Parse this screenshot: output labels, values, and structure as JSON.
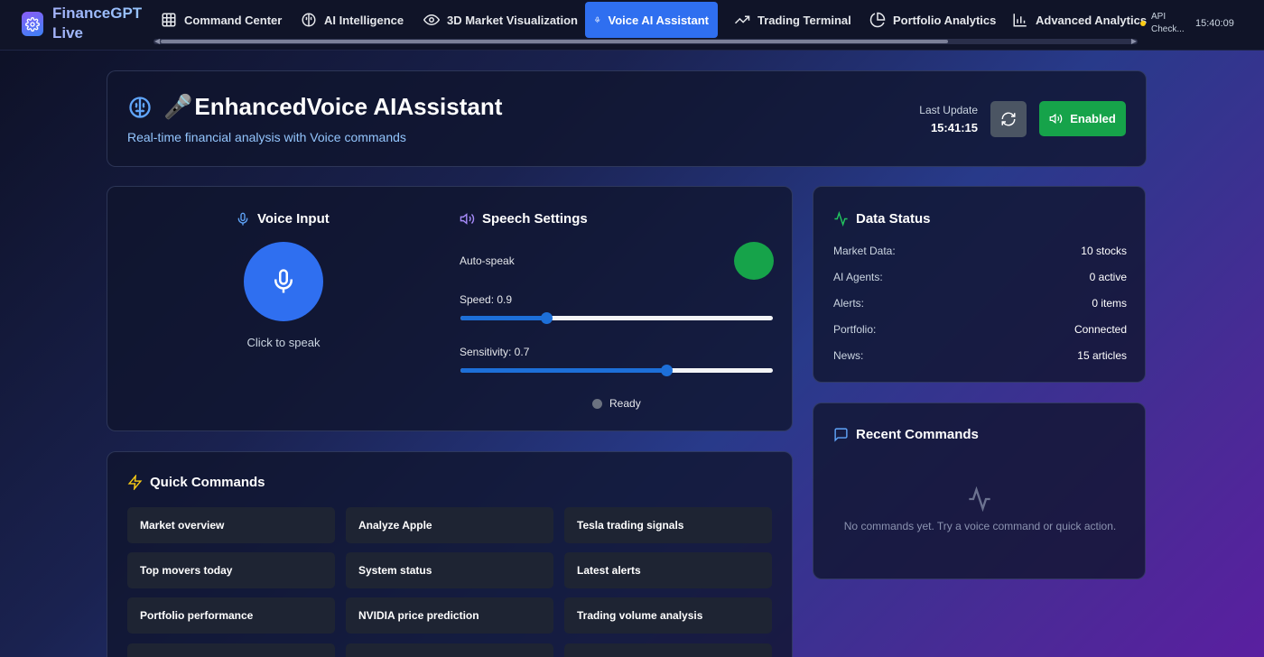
{
  "app": {
    "name": "FinanceGPT Live",
    "clock": "15:40:09",
    "api_status": "API Check..."
  },
  "nav": {
    "tabs": [
      {
        "label": "Command Center",
        "icon": "grid-icon"
      },
      {
        "label": "AI Intelligence",
        "icon": "brain-icon"
      },
      {
        "label": "3D Market Visualization",
        "icon": "eye-icon"
      },
      {
        "label": "Voice AI Assistant",
        "icon": "mic-icon",
        "active": true
      },
      {
        "label": "Trading Terminal",
        "icon": "trending-up-icon"
      },
      {
        "label": "Portfolio Analytics",
        "icon": "pie-chart-icon"
      },
      {
        "label": "Advanced Analytics",
        "icon": "bar-chart-icon"
      }
    ]
  },
  "header": {
    "emoji": "🎤",
    "title": "EnhancedVoice AIAssistant",
    "subtitle": "Real-time financial analysis with Voice commands",
    "last_update_label": "Last Update",
    "last_update_time": "15:41:15",
    "enabled_label": "Enabled"
  },
  "voice": {
    "title": "Voice Input",
    "click_to_speak": "Click to speak"
  },
  "speech": {
    "title": "Speech Settings",
    "auto_speak_label": "Auto-speak",
    "auto_speak_on": true,
    "speed_label": "Speed: 0.9",
    "speed_fraction": 0.275,
    "sensitivity_label": "Sensitivity: 0.7",
    "sensitivity_fraction": 0.66,
    "status": "Ready"
  },
  "data_status": {
    "title": "Data Status",
    "rows": [
      {
        "key": "Market Data:",
        "value": "10 stocks"
      },
      {
        "key": "AI Agents:",
        "value": "0 active"
      },
      {
        "key": "Alerts:",
        "value": "0 items"
      },
      {
        "key": "Portfolio:",
        "value": "Connected"
      },
      {
        "key": "News:",
        "value": "15 articles"
      }
    ]
  },
  "recent": {
    "title": "Recent Commands",
    "empty_text": "No commands yet. Try a voice command or quick action."
  },
  "quick": {
    "title": "Quick Commands",
    "commands": [
      "Market overview",
      "Analyze Apple",
      "Tesla trading signals",
      "Top movers today",
      "System status",
      "Latest alerts",
      "Portfolio performance",
      "NVIDIA price prediction",
      "Trading volume analysis",
      "",
      "",
      ""
    ]
  },
  "colors": {
    "accent": "#2f6ff0",
    "success": "#16a34a",
    "status_icon": "#22c55e",
    "quick_icon": "#facc15",
    "speech_icon": "#a78bfa"
  }
}
